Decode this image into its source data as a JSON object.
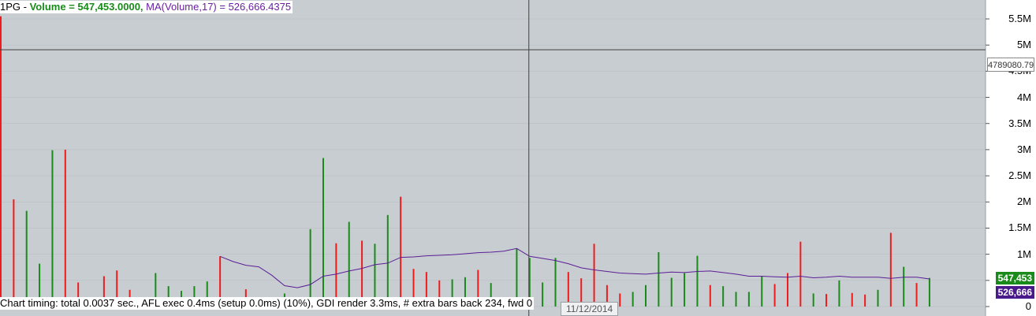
{
  "header": {
    "ticker": "1PG",
    "volume_text": "Volume = 547,453.0000,",
    "ma_text": "MA(Volume,17) = 526,666.4375"
  },
  "timing_text": "Chart timing: total 0.0037 sec., AFL exec 0.4ms (setup 0.0ms) (10%), GDI render 3.3ms, # extra bars back 234, fwd 0",
  "date_label": "11/12/2014",
  "cursor_value": "4789080.79",
  "badges": {
    "volume": "547,453",
    "ma": "526,666"
  },
  "colors": {
    "up": "#1a8a1a",
    "down": "#ee1c1c",
    "ma": "#5a1e96",
    "cursor": "#404040",
    "badge_volume": "#1a8a1a",
    "badge_ma": "#4b1a8a"
  },
  "chart_data": {
    "type": "bar",
    "title": "",
    "xlabel": "",
    "ylabel": "",
    "ylim": [
      0,
      6000000
    ],
    "y_ticks": [
      {
        "value": 0,
        "label": "0"
      },
      {
        "value": 500000,
        "label": "500K"
      },
      {
        "value": 1000000,
        "label": "1M"
      },
      {
        "value": 1500000,
        "label": "1.5M"
      },
      {
        "value": 2000000,
        "label": "2M"
      },
      {
        "value": 2500000,
        "label": "2.5M"
      },
      {
        "value": 3000000,
        "label": "3M"
      },
      {
        "value": 3500000,
        "label": "3.5M"
      },
      {
        "value": 4000000,
        "label": "4M"
      },
      {
        "value": 4500000,
        "label": "4.5M"
      },
      {
        "value": 5000000,
        "label": "5M"
      },
      {
        "value": 5500000,
        "label": "5.5M"
      }
    ],
    "cursor_y": 4789080.79,
    "cursor_bar_index": 41,
    "series": [
      {
        "type": "bar",
        "values": [
          5550000,
          2050000,
          1830000,
          820000,
          2990000,
          3000000,
          460000,
          0,
          580000,
          690000,
          320000,
          180000,
          640000,
          390000,
          300000,
          390000,
          480000,
          960000,
          0,
          330000,
          0,
          0,
          250000,
          0,
          1480000,
          2840000,
          1210000,
          1620000,
          1260000,
          1200000,
          1750000,
          2100000,
          720000,
          660000,
          500000,
          520000,
          560000,
          700000,
          450000,
          0,
          1100000,
          930000,
          460000,
          930000,
          660000,
          540000,
          1200000,
          410000,
          250000,
          280000,
          410000,
          1040000,
          550000,
          640000,
          970000,
          410000,
          390000,
          280000,
          280000,
          580000,
          430000,
          640000,
          1240000,
          250000,
          240000,
          500000,
          260000,
          230000,
          320000,
          1410000,
          760000,
          450000,
          547453
        ],
        "directions": [
          "down",
          "down",
          "up",
          "up",
          "up",
          "down",
          "down",
          "up",
          "down",
          "down",
          "down",
          "down",
          "up",
          "up",
          "up",
          "up",
          "up",
          "down",
          "up",
          "down",
          "down",
          "up",
          "up",
          "up",
          "up",
          "up",
          "down",
          "up",
          "down",
          "up",
          "up",
          "down",
          "down",
          "down",
          "down",
          "up",
          "up",
          "down",
          "up",
          "up",
          "up",
          "up",
          "up",
          "up",
          "down",
          "down",
          "down",
          "down",
          "down",
          "up",
          "up",
          "up",
          "up",
          "up",
          "up",
          "down",
          "up",
          "up",
          "up",
          "up",
          "down",
          "down",
          "down",
          "up",
          "down",
          "up",
          "down",
          "down",
          "up",
          "down",
          "up",
          "down",
          "up"
        ]
      },
      {
        "type": "line",
        "name": "MA(Volume,17)",
        "values": [
          null,
          null,
          null,
          null,
          null,
          null,
          null,
          null,
          null,
          null,
          null,
          null,
          null,
          null,
          null,
          null,
          null,
          960000,
          860000,
          790000,
          760000,
          600000,
          400000,
          360000,
          420000,
          580000,
          620000,
          680000,
          730000,
          800000,
          830000,
          940000,
          950000,
          970000,
          980000,
          990000,
          1010000,
          1030000,
          1040000,
          1060000,
          1110000,
          960000,
          920000,
          880000,
          820000,
          740000,
          700000,
          670000,
          640000,
          630000,
          620000,
          640000,
          660000,
          650000,
          670000,
          680000,
          650000,
          620000,
          580000,
          580000,
          570000,
          560000,
          580000,
          550000,
          560000,
          580000,
          560000,
          560000,
          560000,
          540000,
          560000,
          560000,
          526666
        ]
      }
    ]
  }
}
